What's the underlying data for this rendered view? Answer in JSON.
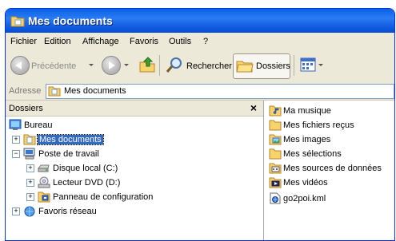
{
  "window": {
    "title": "Mes documents"
  },
  "menu": [
    "Fichier",
    "Edition",
    "Affichage",
    "Favoris",
    "Outils",
    "?"
  ],
  "toolbar": {
    "back_label": "Précédente",
    "search_label": "Rechercher",
    "folders_label": "Dossiers"
  },
  "address": {
    "label": "Adresse",
    "value": "Mes documents"
  },
  "folders_pane": {
    "header": "Dossiers",
    "close_glyph": "×",
    "tree": [
      {
        "label": "Bureau",
        "icon": "desktop-icon"
      },
      {
        "label": "Mes documents",
        "icon": "my-documents-folder-icon"
      },
      {
        "label": "Poste de travail",
        "icon": "my-computer-icon"
      },
      {
        "label": "Disque local (C:)",
        "icon": "hard-disk-icon"
      },
      {
        "label": "Lecteur DVD (D:)",
        "icon": "dvd-drive-icon"
      },
      {
        "label": "Panneau de configuration",
        "icon": "control-panel-icon"
      },
      {
        "label": "Favoris réseau",
        "icon": "network-places-icon"
      }
    ]
  },
  "contents": [
    {
      "label": "Ma musique",
      "icon": "music-folder-icon"
    },
    {
      "label": "Mes fichiers reçus",
      "icon": "folder-icon"
    },
    {
      "label": "Mes images",
      "icon": "pictures-folder-icon"
    },
    {
      "label": "Mes sélections",
      "icon": "folder-icon"
    },
    {
      "label": "Mes sources de données",
      "icon": "data-sources-folder-icon"
    },
    {
      "label": "Mes vidéos",
      "icon": "videos-folder-icon"
    },
    {
      "label": "go2poi.kml",
      "icon": "kml-file-icon"
    }
  ]
}
